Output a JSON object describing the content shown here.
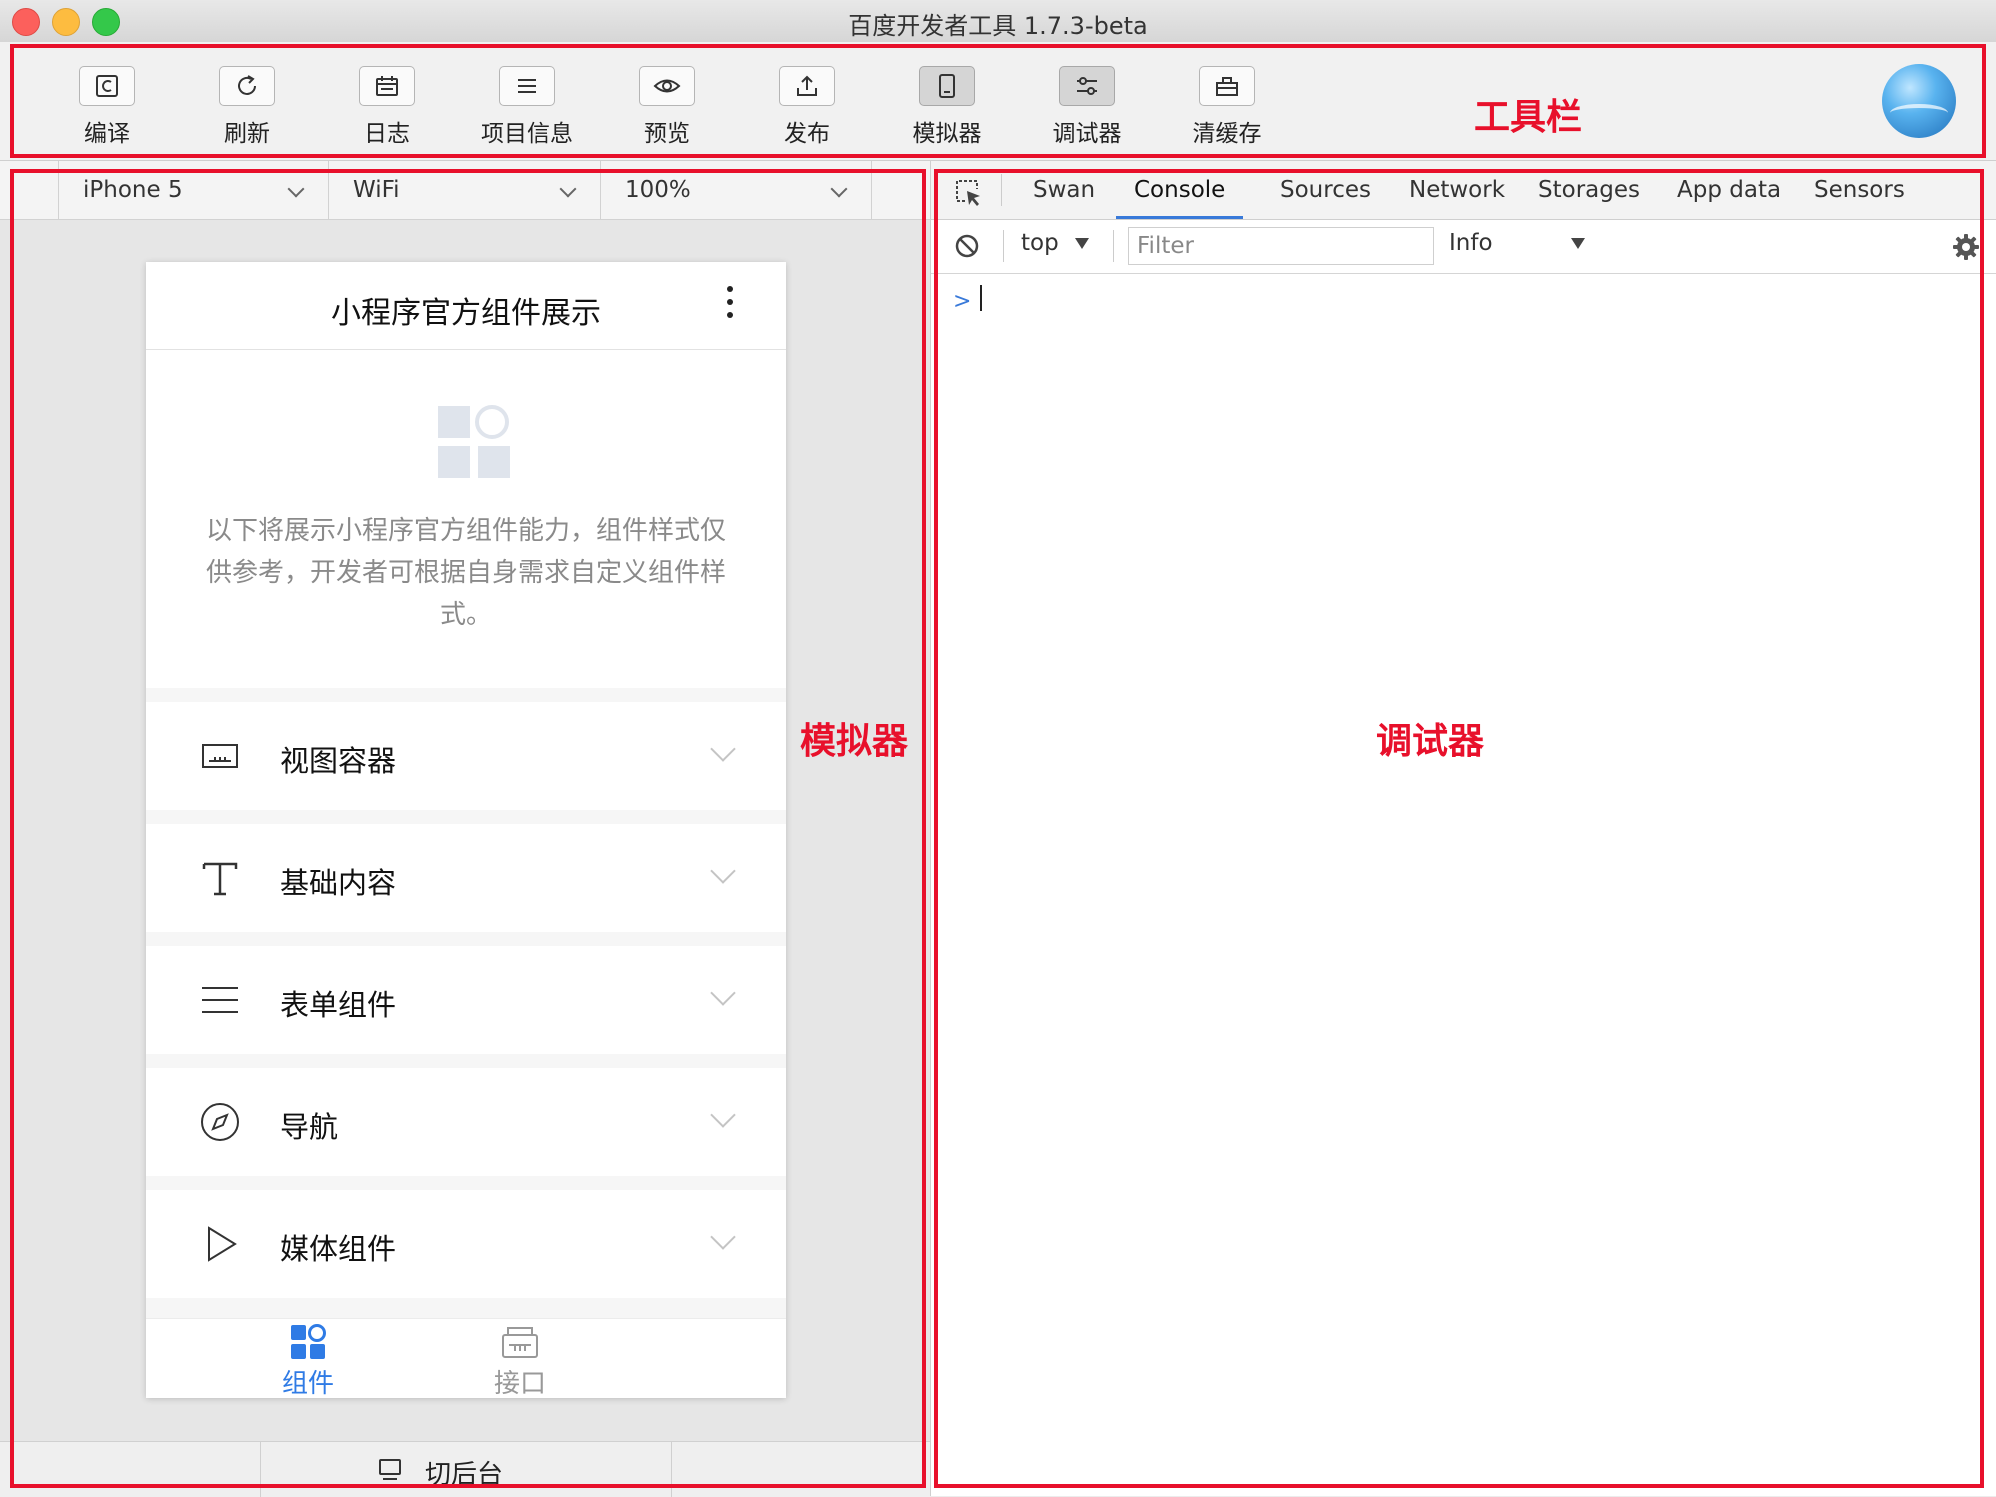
{
  "window": {
    "title": "百度开发者工具 1.7.3-beta"
  },
  "toolbar": {
    "buttons": [
      {
        "label": "编译",
        "icon": "compile-icon"
      },
      {
        "label": "刷新",
        "icon": "refresh-icon"
      },
      {
        "label": "日志",
        "icon": "log-icon"
      },
      {
        "label": "项目信息",
        "icon": "list-icon"
      },
      {
        "label": "预览",
        "icon": "eye-icon"
      },
      {
        "label": "发布",
        "icon": "upload-icon"
      },
      {
        "label": "模拟器",
        "icon": "device-icon",
        "active": true
      },
      {
        "label": "调试器",
        "icon": "sliders-icon",
        "active": true
      },
      {
        "label": "清缓存",
        "icon": "toolbox-icon"
      }
    ],
    "avatar_icon": "user-avatar"
  },
  "simulator": {
    "device": "iPhone 5",
    "network": "WiFi",
    "zoom": "100%",
    "page_title": "小程序官方组件展示",
    "intro_text": "以下将展示小程序官方组件能力，组件样式仅供参考，开发者可根据自身需求自定义组件样式。",
    "categories": [
      {
        "label": "视图容器",
        "icon": "view-container-icon"
      },
      {
        "label": "基础内容",
        "icon": "text-t-icon"
      },
      {
        "label": "表单组件",
        "icon": "menu-lines-icon"
      },
      {
        "label": "导航",
        "icon": "compass-icon"
      },
      {
        "label": "媒体组件",
        "icon": "play-icon"
      }
    ],
    "tabs": [
      {
        "label": "组件",
        "icon": "components-icon",
        "active": true
      },
      {
        "label": "接口",
        "icon": "api-icon",
        "active": false
      }
    ],
    "background_button": "切后台"
  },
  "debugger": {
    "tabs": [
      "Swan",
      "Console",
      "Sources",
      "Network",
      "Storages",
      "App data",
      "Sensors"
    ],
    "active_tab": "Console",
    "context": "top",
    "filter_placeholder": "Filter",
    "level": "Info",
    "prompt": ">"
  },
  "annotations": {
    "toolbar": "工具栏",
    "simulator": "模拟器",
    "debugger": "调试器"
  },
  "colors": {
    "annotation": "#e8102b",
    "accent_blue": "#3879d9",
    "tab_active": "#2f7be5",
    "tab_inactive": "#999999"
  }
}
